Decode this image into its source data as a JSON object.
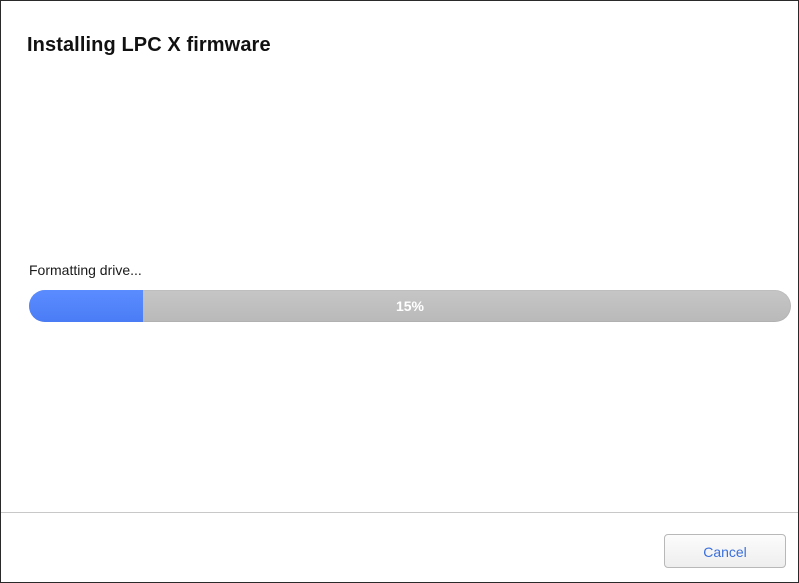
{
  "dialog": {
    "title": "Installing LPC X firmware",
    "status_text": "Formatting drive...",
    "progress": {
      "value_percent": 15,
      "label": "15%"
    },
    "buttons": {
      "cancel_label": "Cancel"
    }
  },
  "colors": {
    "progress_fill": "#4f83ff",
    "progress_track": "#bfbfbf",
    "button_text": "#3a6fdc"
  }
}
